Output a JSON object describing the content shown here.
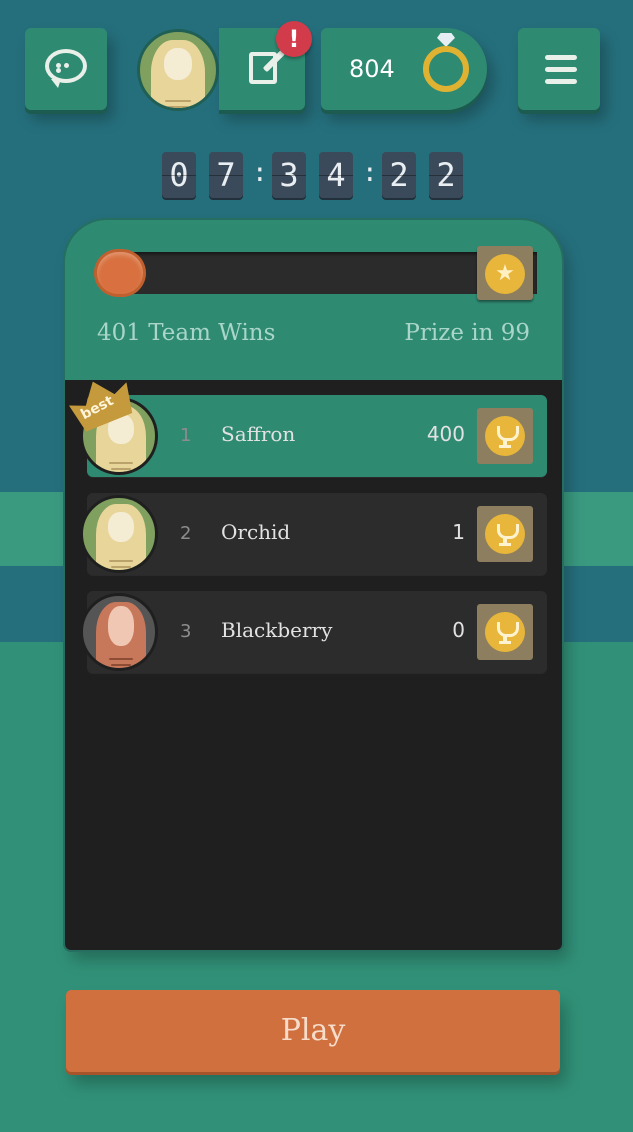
{
  "header": {
    "notification_badge": "!",
    "currency_amount": "804",
    "currency_icon": "ring-icon"
  },
  "timer": {
    "digits": [
      "0",
      "7",
      "3",
      "4",
      "2",
      "2"
    ],
    "separator": ":"
  },
  "team": {
    "progress_fraction": 0.0,
    "wins_label": "401 Team Wins",
    "prize_label": "Prize in 99"
  },
  "leaderboard": [
    {
      "rank": "1",
      "name": "Saffron",
      "score": "400",
      "badge": "best"
    },
    {
      "rank": "2",
      "name": "Orchid",
      "score": "1"
    },
    {
      "rank": "3",
      "name": "Blackberry",
      "score": "0"
    }
  ],
  "play_button": "Play",
  "colors": {
    "accent_orange": "#d0703e",
    "panel_green": "#2f8a72",
    "header_teal": "#256f7c",
    "gold": "#e7b63a"
  }
}
